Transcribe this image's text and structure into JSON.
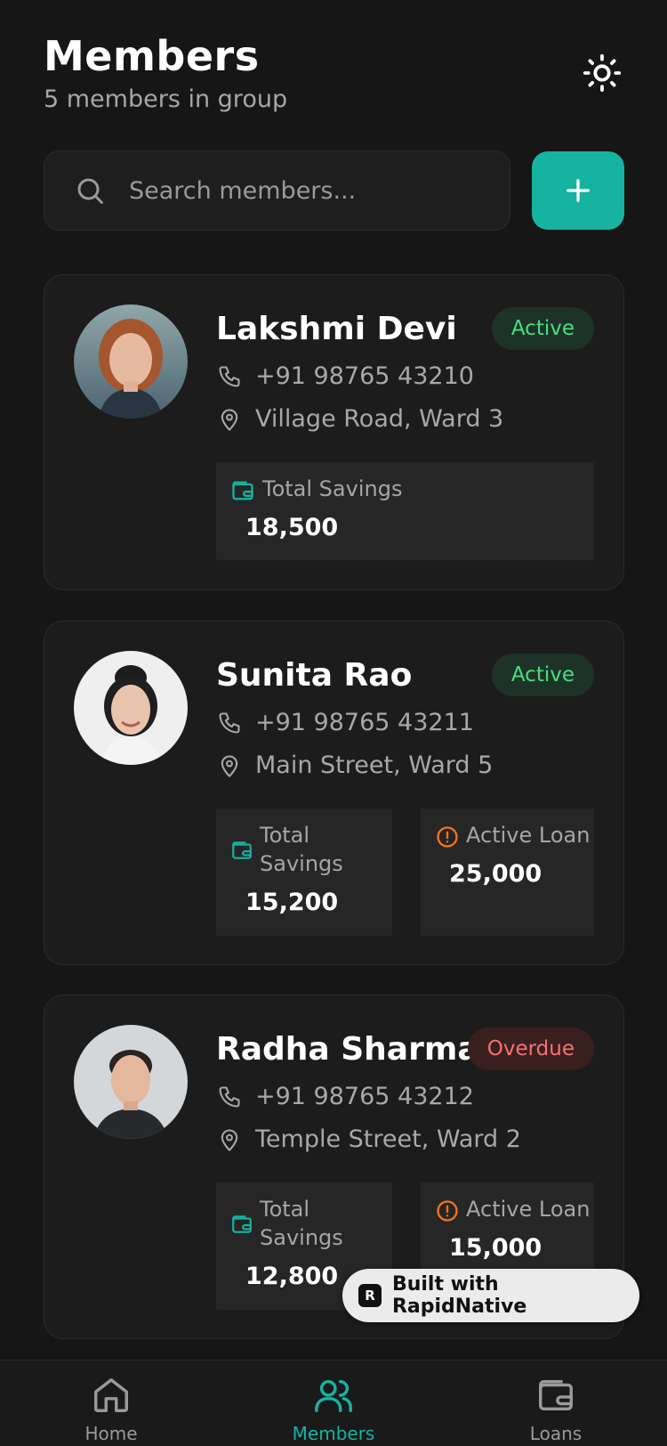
{
  "header": {
    "title": "Members",
    "subtitle": "5 members in group"
  },
  "search": {
    "placeholder": "Search members..."
  },
  "colors": {
    "accent": "#16b3a0",
    "active": "#4ade80",
    "overdue": "#f87171",
    "loan_icon": "#f97316"
  },
  "members": [
    {
      "name": "Lakshmi Devi",
      "status": "Active",
      "phone": "+91 98765 43210",
      "address": "Village Road, Ward 3",
      "savings_label": "Total Savings",
      "savings": "18,500"
    },
    {
      "name": "Sunita Rao",
      "status": "Active",
      "phone": "+91 98765 43211",
      "address": "Main Street, Ward 5",
      "savings_label_1": "Total",
      "savings_label_2": "Savings",
      "savings": "15,200",
      "loan_label": "Active Loan",
      "loan": "25,000"
    },
    {
      "name": "Radha Sharma",
      "status": "Overdue",
      "phone": "+91 98765 43212",
      "address": "Temple Street, Ward 2",
      "savings_label_1": "Total",
      "savings_label_2": "Savings",
      "savings": "12,800",
      "loan_label": "Active Loan",
      "loan": "15,000"
    }
  ],
  "built_with": {
    "logo": "R",
    "label": "Built with RapidNative"
  },
  "tabs": [
    {
      "label": "Home",
      "icon": "home-icon"
    },
    {
      "label": "Members",
      "icon": "users-icon"
    },
    {
      "label": "Loans",
      "icon": "wallet-icon"
    }
  ]
}
